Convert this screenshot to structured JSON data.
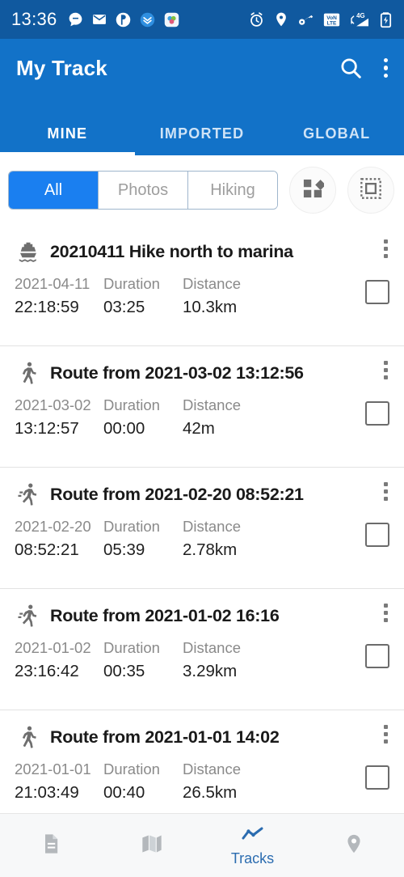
{
  "statusbar": {
    "time": "13:36",
    "left_icons": [
      "message-bubble-icon",
      "email-icon",
      "app-circle-icon",
      "download-chevron-icon",
      "app-color-icon"
    ],
    "right_icons": [
      "alarm-clock-icon",
      "location-pin-icon",
      "vpn-key-icon",
      "volte-icon",
      "signal-4g-icon",
      "battery-icon"
    ],
    "volte_top": "VoN",
    "volte_bottom": "LTE",
    "network": "4G"
  },
  "appbar": {
    "title": "My Track",
    "search_icon": "search-icon",
    "overflow_icon": "overflow-menu-icon",
    "tabs": [
      {
        "label": "MINE",
        "active": true
      },
      {
        "label": "IMPORTED",
        "active": false
      },
      {
        "label": "GLOBAL",
        "active": false
      }
    ]
  },
  "filterbar": {
    "segments": [
      {
        "label": "All",
        "active": true
      },
      {
        "label": "Photos",
        "active": false
      },
      {
        "label": "Hiking",
        "active": false
      }
    ],
    "buttons": [
      {
        "name": "shapes-icon"
      },
      {
        "name": "selection-box-icon"
      }
    ]
  },
  "list": {
    "labels": {
      "duration": "Duration",
      "distance": "Distance"
    },
    "rows": [
      {
        "icon": "ferry-icon",
        "title": "20210411 Hike north to marina",
        "date": "2021-04-11",
        "time": "22:18:59",
        "duration": "03:25",
        "distance": "10.3km",
        "checked": false
      },
      {
        "icon": "walking-icon",
        "title": "Route from 2021-03-02 13:12:56",
        "date": "2021-03-02",
        "time": "13:12:57",
        "duration": "00:00",
        "distance": "42m",
        "checked": false
      },
      {
        "icon": "running-icon",
        "title": "Route from 2021-02-20 08:52:21",
        "date": "2021-02-20",
        "time": "08:52:21",
        "duration": "05:39",
        "distance": "2.78km",
        "checked": false
      },
      {
        "icon": "running-icon",
        "title": "Route from 2021-01-02 16:16",
        "date": "2021-01-02",
        "time": "23:16:42",
        "duration": "00:35",
        "distance": "3.29km",
        "checked": false
      },
      {
        "icon": "walking-icon",
        "title": "Route from 2021-01-01 14:02",
        "date": "2021-01-01",
        "time": "21:03:49",
        "duration": "00:40",
        "distance": "26.5km",
        "checked": false
      }
    ]
  },
  "bottomnav": {
    "items": [
      {
        "icon": "document-icon",
        "label": "",
        "active": false
      },
      {
        "icon": "map-icon",
        "label": "",
        "active": false
      },
      {
        "icon": "tracks-chart-icon",
        "label": "Tracks",
        "active": true
      },
      {
        "icon": "location-pin-icon",
        "label": "",
        "active": false
      }
    ]
  },
  "colors": {
    "statusbar_blue": "#10599F",
    "appbar_blue": "#1272C8",
    "accent_blue": "#1a7ff0",
    "active_nav_blue": "#2b6cb0",
    "icon_gray": "#8a8a8a"
  }
}
